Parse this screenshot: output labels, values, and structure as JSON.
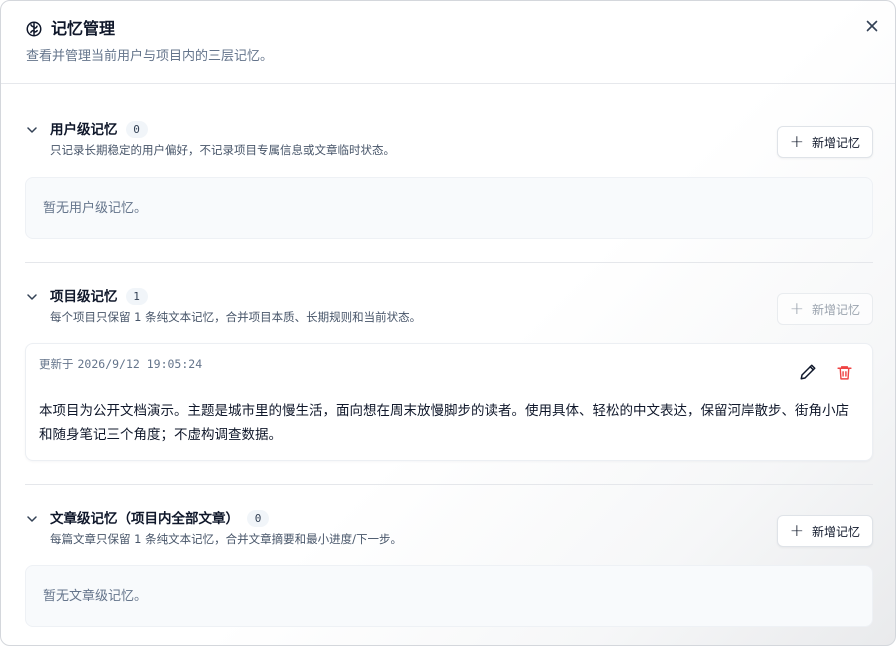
{
  "dialog": {
    "title": "记忆管理",
    "subtitle": "查看并管理当前用户与项目内的三层记忆。"
  },
  "sections": {
    "user": {
      "title": "用户级记忆",
      "count": "0",
      "description": "只记录长期稳定的用户偏好，不记录项目专属信息或文章临时状态。",
      "add_label": "新增记忆",
      "empty_text": "暂无用户级记忆。"
    },
    "project": {
      "title": "项目级记忆",
      "count": "1",
      "description": "每个项目只保留 1 条纯文本记忆，合并项目本质、长期规则和当前状态。",
      "add_label": "新增记忆",
      "add_disabled": true,
      "memory": {
        "updated_label": "更新于",
        "updated_at": "2026/9/12 19:05:24",
        "content": "本项目为公开文档演示。主题是城市里的慢生活，面向想在周末放慢脚步的读者。使用具体、轻松的中文表达，保留河岸散步、街角小店和随身笔记三个角度；不虚构调查数据。"
      }
    },
    "article": {
      "title": "文章级记忆（项目内全部文章）",
      "count": "0",
      "description": "每篇文章只保留 1 条纯文本记忆，合并文章摘要和最小进度/下一步。",
      "add_label": "新增记忆",
      "empty_text": "暂无文章级记忆。"
    }
  },
  "icons": {
    "title": "brain-icon",
    "close": "close-icon",
    "collapse": "chevron-down-icon",
    "add": "plus-icon",
    "edit": "pencil-icon",
    "delete": "trash-icon"
  },
  "colors": {
    "delete": "#ef4444",
    "muted": "#64748b",
    "empty_bg": "#f8fafc"
  }
}
